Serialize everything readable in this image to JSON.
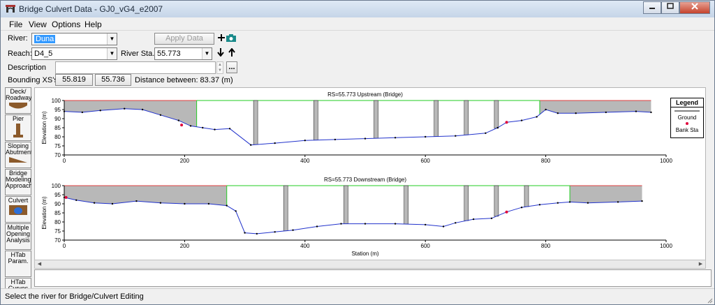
{
  "window": {
    "title": "Bridge Culvert Data - GJ0_vG4_e2007",
    "colors": {
      "title_bg": "#c5d5e8",
      "accent": "#3399ff"
    }
  },
  "menu": [
    "File",
    "View",
    "Options",
    "Help"
  ],
  "form": {
    "river_label": "River:",
    "river_value": "Duna",
    "reach_label": "Reach:",
    "reach_value": "D4_5",
    "river_sta_label": "River Sta.:",
    "river_sta_value": "55.773",
    "description_label": "Description",
    "bounding_label": "Bounding XS's:",
    "bounding_up": "55.819",
    "bounding_down": "55.736",
    "distance_text": "Distance between: 83.37 (m)",
    "apply_label": "Apply Data",
    "ellipsis": "..."
  },
  "toolbar": [
    {
      "label": "Deck/ Roadway",
      "icon": "deck-icon"
    },
    {
      "label": "Pier",
      "icon": "pier-icon"
    },
    {
      "label": "Sloping Abutment",
      "icon": "abutment-icon"
    },
    {
      "label": "Bridge Modeling Approach",
      "icon": "bridge-icon"
    },
    {
      "label": "Culvert",
      "icon": "culvert-icon"
    },
    {
      "label": "Multiple Opening Analysis",
      "icon": "multi-icon"
    },
    {
      "label": "HTab Param.",
      "icon": ""
    },
    {
      "label": "HTab Curves",
      "icon": ""
    }
  ],
  "status": {
    "text": "Select the river for Bridge/Culvert Editing"
  },
  "legend": {
    "title": "Legend",
    "items": [
      "Ground",
      "Bank Sta"
    ]
  },
  "chart_data": [
    {
      "type": "line",
      "title": "RS=55.773  Upstream  (Bridge)",
      "ylabel": "Elevation (m)",
      "xlabel": "",
      "xlim": [
        0,
        1000
      ],
      "ylim": [
        70,
        100
      ],
      "xticks": [
        0,
        200,
        400,
        600,
        800,
        1000
      ],
      "yticks": [
        70,
        75,
        80,
        85,
        90,
        95,
        100
      ],
      "deck": {
        "high": 100,
        "left_end": 220,
        "right_end": 790
      },
      "piers": [
        318,
        418,
        518,
        618,
        668,
        718
      ],
      "bank_sta": [
        [
          195,
          86.5
        ],
        [
          735,
          88
        ]
      ],
      "ground": {
        "x": [
          0,
          30,
          60,
          100,
          130,
          160,
          190,
          210,
          230,
          250,
          275,
          310,
          350,
          400,
          450,
          500,
          550,
          600,
          650,
          700,
          720,
          735,
          760,
          785,
          800,
          820,
          850,
          900,
          950,
          975
        ],
        "y": [
          94,
          93.5,
          94.5,
          95.5,
          95,
          92,
          89,
          86,
          85,
          84,
          84.5,
          75.5,
          76.5,
          78,
          78.5,
          79,
          79.5,
          80,
          80.5,
          82,
          85,
          88,
          89,
          91,
          95,
          93,
          93,
          93.5,
          94,
          93.5
        ]
      }
    },
    {
      "type": "line",
      "title": "RS=55.773  Downstream  (Bridge)",
      "ylabel": "Elevation (m)",
      "xlabel": "Station (m)",
      "xlim": [
        0,
        1000
      ],
      "ylim": [
        70,
        100
      ],
      "xticks": [
        0,
        200,
        400,
        600,
        800,
        1000
      ],
      "yticks": [
        70,
        75,
        80,
        85,
        90,
        95,
        100
      ],
      "deck": {
        "high": 100,
        "left_end": 270,
        "right_end": 840
      },
      "piers": [
        368,
        468,
        568,
        668,
        718,
        768
      ],
      "bank_sta": [
        [
          3,
          93.5
        ],
        [
          735,
          85.5
        ]
      ],
      "ground": {
        "x": [
          0,
          20,
          50,
          80,
          120,
          160,
          200,
          240,
          270,
          285,
          300,
          320,
          350,
          380,
          420,
          460,
          500,
          550,
          600,
          630,
          650,
          680,
          710,
          735,
          760,
          790,
          820,
          840,
          870,
          920,
          960
        ],
        "y": [
          93.5,
          92,
          90.5,
          90,
          91.5,
          90.5,
          90,
          90,
          89,
          86,
          74,
          73.5,
          74.5,
          75.5,
          77.5,
          79,
          79,
          79,
          78.5,
          77.5,
          79.5,
          81.5,
          82,
          85.5,
          88,
          89.5,
          90.5,
          91,
          90.5,
          91,
          91.5
        ]
      }
    }
  ]
}
